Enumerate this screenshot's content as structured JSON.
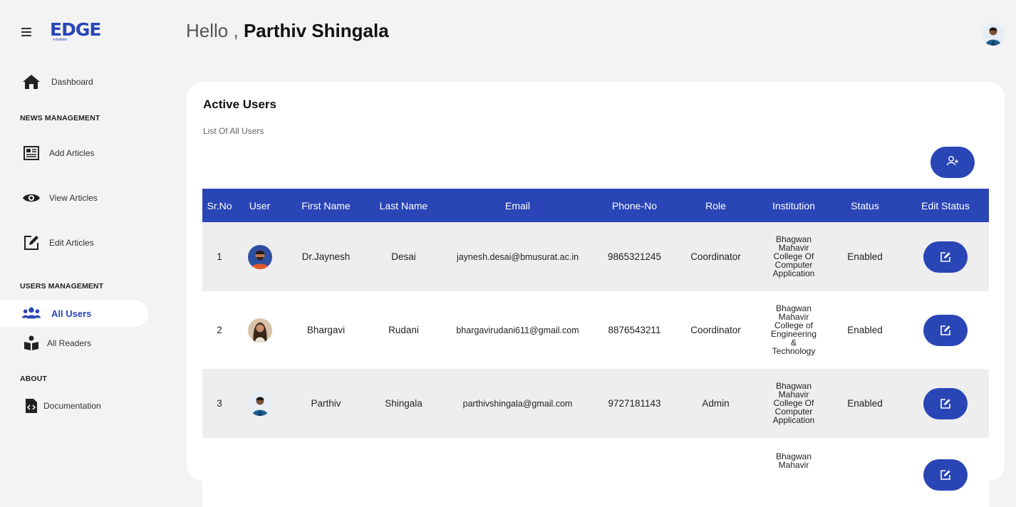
{
  "app": {
    "logo_text": "EDGE",
    "logo_tagline": "e-bulletin"
  },
  "sidebar": {
    "dashboard_label": "Dashboard",
    "news_section_title": "NEWS MANAGEMENT",
    "add_articles_label": "Add Articles",
    "view_articles_label": "View Articles",
    "edit_articles_label": "Edit Articles",
    "users_section_title": "USERS MANAGEMENT",
    "all_users_label": "All Users",
    "all_readers_label": "All Readers",
    "about_section_title": "ABOUT",
    "documentation_label": "Documentation",
    "accent_color": "#2945b6"
  },
  "header": {
    "greeting_prefix": "Hello ,",
    "user_name": "Parthiv Shingala"
  },
  "card": {
    "title": "Active Users",
    "subtitle": "List Of All Users"
  },
  "table": {
    "columns": [
      "Sr.No",
      "User",
      "First Name",
      "Last Name",
      "Email",
      "Phone-No",
      "Role",
      "Institution",
      "Status",
      "Edit Status"
    ],
    "rows": [
      {
        "sr": "1",
        "first_name": "Dr.Jaynesh",
        "last_name": "Desai",
        "email": "jaynesh.desai@bmusurat.ac.in",
        "phone": "9865321245",
        "role": "Coordinator",
        "institution": "Bhagwan Mahavir College Of Computer Application",
        "status": "Enabled"
      },
      {
        "sr": "2",
        "first_name": "Bhargavi",
        "last_name": "Rudani",
        "email": "bhargavirudani611@gmail.com",
        "phone": "8876543211",
        "role": "Coordinator",
        "institution": "Bhagwan Mahavir College of Engineering & Technology",
        "status": "Enabled"
      },
      {
        "sr": "3",
        "first_name": "Parthiv",
        "last_name": "Shingala",
        "email": "parthivshingala@gmail.com",
        "phone": "9727181143",
        "role": "Admin",
        "institution": "Bhagwan Mahavir College Of Computer Application",
        "status": "Enabled"
      },
      {
        "sr": "",
        "first_name": "",
        "last_name": "",
        "email": "",
        "phone": "",
        "role": "",
        "institution": "Bhagwan Mahavir",
        "status": ""
      }
    ]
  }
}
